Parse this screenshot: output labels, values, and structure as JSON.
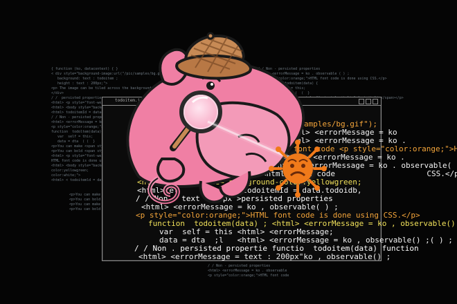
{
  "background_code": {
    "left": [
      "{ function (ko, datacontext) { }",
      "< div style=\"background-image:url(\"/pic/samples/bg.gif\");",
      "   background: text : todoitem ;",
      "   height : text : 200px;\">",
      "<p> The image can be tiled across the background, while the text runs across the top.</p>",
      "</div>",
      "",
      "/ /  persisted properties",
      "",
      "<html> <p style=\"font-weight",
      "<html> <body style=\"backgr",
      "<html> todoitemId = datac",
      "",
      "/ / Non - persisted properti",
      "<html> <errorMessage = ko",
      "",
      "<p style=\"color:orange;\">HT",
      "",
      "function  todoltem(data){",
      "   var  self = this;",
      "   data = dta  ( (  }",
      "<p>You can make <span style",
      "<p>You can bold <span style",
      "",
      "<html> <p style=\"font-weigh",
      "HTML font code is done using",
      "<html> <body style=\"backgr",
      "color:yellowgreen;",
      "color:white;\">",
      "<html> < todoitemld = datac"
    ],
    "right": [
      "/ / Non - persisted properties",
      "<html> <errorMessage = ko . observable ( ) ;",
      "",
      "<p style=\"color:orange;\">HTML font code is done using CSS.</p>",
      "",
      "   function  todoitem(data) {",
      "      var  self = this;",
      "      data = dta  (  (  }",
      "",
      "<p>You can make <span style=\"font-style:italic\">font italic</span></p>"
    ],
    "bottom_left": [
      "<p>You can make <span style=\"font-st",
      "<p>You can bold <span style=\"font-weig",
      "<p>You can make <span style=\"font-st",
      "<p>You can bold <span style=\"font-weig"
    ],
    "bottom_center": [
      "/ / Non - persisted properties",
      "<html> <errorMessage = ko . observable",
      "<p style=\"color:orange;\">HTML font code"
    ]
  },
  "window": {
    "title": "todoitem.js - persisted properties"
  },
  "code_lines": [
    "(\"/pic/samples/bg.gif\");",
    "<html> <errorMessage = ko",
    "<html> <errorMessage = ko .",
    "      font code <p style=\"color:orange;\">HTML",
    "<html> <errorMessage = ko .",
    "<html> <errorMessage = ko . observable( ) ;",
    "<html> font code                    CSS.</p>",
    "<html> <body style=\"background-color:yellowgreen;",
    "<html>tel            < todoitemId = data.todoidb,",
    "/ / Non - text :200px\">persisted properties",
    "<html> <errorMessage = ko , observable( ) ;",
    "<p style=\"color:orange;\">HTML font code is done using CSS.</p>",
    "function  todoitem(data) ; <html> <errorMessage = ko , observable() ;",
    "var  self = this <html> <errorMessage;",
    "data = dta  ;l   <html> <errorMessage = ko , observable() ;( ) ;",
    "/ / Non . persisted propertie functio  todoitem(data) function",
    "<html> <errorMessage = text : 200px\"ko , observable() ;"
  ],
  "colors": {
    "background": "#050505",
    "window_border": "#8c8c8c",
    "pig_pink": "#f07fa4",
    "pig_outline": "#1a1a1a",
    "hat_tan": "#c78a55",
    "virus_orange": "#f07a1a",
    "code_orange": "#f4a53a"
  },
  "illustration": {
    "pig": "detective-pig",
    "hat": "deerstalker-hat",
    "tool": "magnifying-glass",
    "bug": "virus-bug"
  }
}
